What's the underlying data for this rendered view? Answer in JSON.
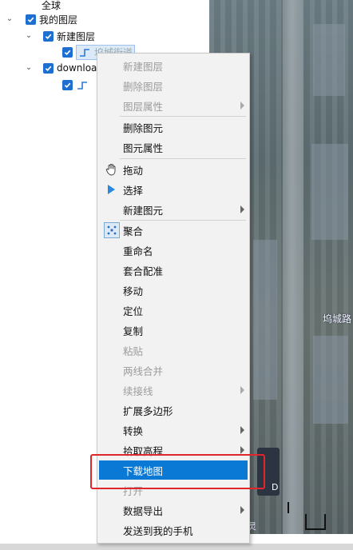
{
  "tree": {
    "root": "全球",
    "my_layers": "我的图层",
    "new_layer": "新建图层",
    "child_selected": "坞城街道",
    "download": "download"
  },
  "map": {
    "label": "坞城路",
    "small_label": "灵",
    "d_label": "D"
  },
  "menu": {
    "items": [
      {
        "label": "新建图层",
        "disabled": true
      },
      {
        "label": "删除图层",
        "disabled": true
      },
      {
        "label": "图层属性",
        "disabled": true,
        "submenu": true
      },
      {
        "label": "删除图元"
      },
      {
        "label": "图元属性"
      },
      {
        "label": "拖动",
        "icon": "hand-icon"
      },
      {
        "label": "选择",
        "icon": "pointer-icon"
      },
      {
        "label": "新建图元",
        "submenu": true
      },
      {
        "label": "聚合",
        "icon": "cluster-icon"
      },
      {
        "label": "重命名"
      },
      {
        "label": "套合配准"
      },
      {
        "label": "移动"
      },
      {
        "label": "定位"
      },
      {
        "label": "复制"
      },
      {
        "label": "粘贴",
        "disabled": true
      },
      {
        "label": "两线合并",
        "disabled": true
      },
      {
        "label": "续接线",
        "disabled": true,
        "submenu": true
      },
      {
        "label": "扩展多边形"
      },
      {
        "label": "转换",
        "submenu": true
      },
      {
        "label": "拾取高程",
        "submenu": true
      },
      {
        "label": "下载地图",
        "highlighted": true
      },
      {
        "label": "打开",
        "disabled": true
      },
      {
        "label": "数据导出",
        "submenu": true
      },
      {
        "label": "发送到我的手机"
      }
    ]
  },
  "colors": {
    "highlight": "#0a79d6",
    "annotation": "#e0262a",
    "checkbox": "#1f6fd1"
  }
}
